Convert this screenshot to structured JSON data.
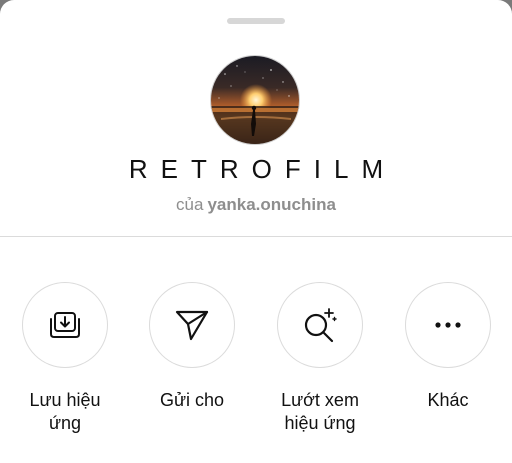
{
  "effect": {
    "name": "RETROFILM",
    "by_prefix": "của",
    "creator": "yanka.onuchina",
    "avatar_icon": "sunset-sea-photo"
  },
  "actions": [
    {
      "icon": "save-tray-icon",
      "label": "Lưu hiệu\nứng"
    },
    {
      "icon": "send-icon",
      "label": "Gửi cho"
    },
    {
      "icon": "browse-effects-icon",
      "label": "Lướt xem\nhiệu ứng"
    },
    {
      "icon": "more-icon",
      "label": "Khác"
    }
  ],
  "colors": {
    "divider": "#dbdbdb",
    "secondary_text": "#8e8e8e",
    "primary_text": "#111111"
  }
}
